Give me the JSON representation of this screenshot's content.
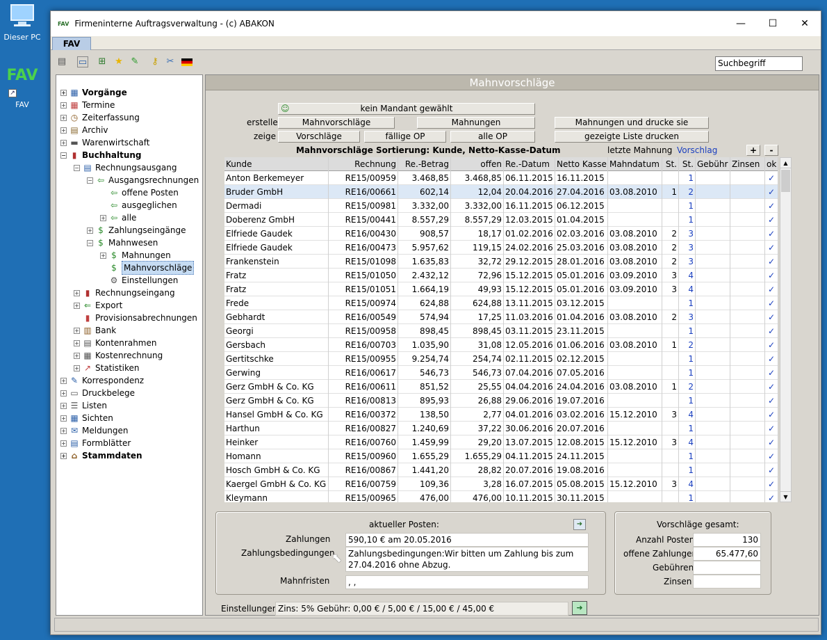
{
  "desktop": {
    "pc_label": "Dieser PC",
    "fav_big": "FAV",
    "fav_label": "FAV"
  },
  "window": {
    "title": "Firmeninterne Auftragsverwaltung - (c) ABAKON",
    "app_icon": "FAV",
    "minimize": "—",
    "maximize": "☐",
    "close": "✕"
  },
  "tab": {
    "label": "FAV"
  },
  "search": {
    "placeholder": "Suchbegriff"
  },
  "tree": [
    {
      "label": "Vorgänge",
      "bold": true,
      "level": 0,
      "exp": "+",
      "icon": "docs-icon"
    },
    {
      "label": "Termine",
      "level": 0,
      "exp": "+",
      "icon": "calendar-icon"
    },
    {
      "label": "Zeiterfassung",
      "level": 0,
      "exp": "+",
      "icon": "clock-icon"
    },
    {
      "label": "Archiv",
      "level": 0,
      "exp": "+",
      "icon": "archive-icon"
    },
    {
      "label": "Warenwirtschaft",
      "level": 0,
      "exp": "+",
      "icon": "truck-icon"
    },
    {
      "label": "Buchhaltung",
      "bold": true,
      "level": 0,
      "exp": "−",
      "icon": "chart-icon"
    },
    {
      "label": "Rechnungsausgang",
      "level": 1,
      "exp": "−",
      "icon": "invoice-out-icon"
    },
    {
      "label": "Ausgangsrechnungen",
      "level": 2,
      "exp": "−",
      "icon": "doc-arrow-icon"
    },
    {
      "label": "offene Posten",
      "level": 3,
      "exp": "",
      "icon": "doc-arrow-icon"
    },
    {
      "label": "ausgeglichen",
      "level": 3,
      "exp": "",
      "icon": "doc-arrow-icon"
    },
    {
      "label": "alle",
      "level": 3,
      "exp": "+",
      "icon": "doc-arrow-icon"
    },
    {
      "label": "Zahlungseingänge",
      "level": 2,
      "exp": "+",
      "icon": "payment-icon"
    },
    {
      "label": "Mahnwesen",
      "level": 2,
      "exp": "−",
      "icon": "dunning-icon"
    },
    {
      "label": "Mahnungen",
      "level": 3,
      "exp": "+",
      "icon": "dunning-icon"
    },
    {
      "label": "Mahnvorschläge",
      "level": 3,
      "exp": "",
      "icon": "dunning-icon",
      "selected": true
    },
    {
      "label": "Einstellungen",
      "level": 3,
      "exp": "",
      "icon": "gear-icon"
    },
    {
      "label": "Rechnungseingang",
      "level": 1,
      "exp": "+",
      "icon": "chart-icon"
    },
    {
      "label": "Export",
      "level": 1,
      "exp": "+",
      "icon": "export-icon"
    },
    {
      "label": "Provisionsabrechnungen",
      "level": 1,
      "exp": "",
      "icon": "commission-icon"
    },
    {
      "label": "Bank",
      "level": 1,
      "exp": "+",
      "icon": "bank-icon"
    },
    {
      "label": "Kontenrahmen",
      "level": 1,
      "exp": "+",
      "icon": "ledger-icon"
    },
    {
      "label": "Kostenrechnung",
      "level": 1,
      "exp": "+",
      "icon": "calculator-icon"
    },
    {
      "label": "Statistiken",
      "level": 1,
      "exp": "+",
      "icon": "stats-icon"
    },
    {
      "label": "Korrespondenz",
      "level": 0,
      "exp": "+",
      "icon": "letter-icon"
    },
    {
      "label": "Druckbelege",
      "level": 0,
      "exp": "+",
      "icon": "printer-icon"
    },
    {
      "label": "Listen",
      "level": 0,
      "exp": "+",
      "icon": "list-icon"
    },
    {
      "label": "Sichten",
      "level": 0,
      "exp": "+",
      "icon": "grid-icon"
    },
    {
      "label": "Meldungen",
      "level": 0,
      "exp": "+",
      "icon": "mail-icon"
    },
    {
      "label": "Formblätter",
      "level": 0,
      "exp": "+",
      "icon": "form-icon"
    },
    {
      "label": "Stammdaten",
      "bold": true,
      "level": 0,
      "exp": "+",
      "icon": "house-icon"
    }
  ],
  "main": {
    "title": "Mahnvorschläge",
    "mandant_button": "kein Mandant gewählt",
    "erstelle_label": "erstelle",
    "zeige_label": "zeige",
    "buttons": {
      "mahnvorschlaege": "Mahnvorschläge",
      "mahnungen": "Mahnungen",
      "mahnungen_drucken": "Mahnungen und drucke sie",
      "vorschlaege": "Vorschläge",
      "faellige_op": "fällige OP",
      "alle_op": "alle OP",
      "liste_drucken": "gezeigte Liste drucken",
      "plus": "+",
      "minus": "-"
    },
    "sort_label": "Mahnvorschläge Sortierung: Kunde, Netto-Kasse-Datum",
    "letzte_mahnung_label": "letzte Mahnung",
    "vorschlag_link": "Vorschlag",
    "columns": [
      "Kunde",
      "Rechnung",
      "Re.-Betrag",
      "offen",
      "Re.-Datum",
      "Netto Kasse",
      "Mahndatum",
      "St.",
      "St.",
      "Gebühr",
      "Zinsen",
      "ok"
    ],
    "rows": [
      [
        "Anton Berkemeyer",
        "RE15/00959",
        "3.468,85",
        "3.468,85",
        "06.11.2015",
        "16.11.2015",
        "",
        "",
        "1",
        "",
        "",
        "✓"
      ],
      [
        "Bruder GmbH",
        "RE16/00661",
        "602,14",
        "12,04",
        "20.04.2016",
        "27.04.2016",
        "03.08.2010",
        "1",
        "2",
        "",
        "",
        "✓"
      ],
      [
        "Dermadi",
        "RE15/00981",
        "3.332,00",
        "3.332,00",
        "16.11.2015",
        "06.12.2015",
        "",
        "",
        "1",
        "",
        "",
        "✓"
      ],
      [
        "Doberenz GmbH",
        "RE15/00441",
        "8.557,29",
        "8.557,29",
        "12.03.2015",
        "01.04.2015",
        "",
        "",
        "1",
        "",
        "",
        "✓"
      ],
      [
        "Elfriede Gaudek",
        "RE16/00430",
        "908,57",
        "18,17",
        "01.02.2016",
        "02.03.2016",
        "03.08.2010",
        "2",
        "3",
        "",
        "",
        "✓"
      ],
      [
        "Elfriede Gaudek",
        "RE16/00473",
        "5.957,62",
        "119,15",
        "24.02.2016",
        "25.03.2016",
        "03.08.2010",
        "2",
        "3",
        "",
        "",
        "✓"
      ],
      [
        "Frankenstein",
        "RE15/01098",
        "1.635,83",
        "32,72",
        "29.12.2015",
        "28.01.2016",
        "03.08.2010",
        "2",
        "3",
        "",
        "",
        "✓"
      ],
      [
        "Fratz",
        "RE15/01050",
        "2.432,12",
        "72,96",
        "15.12.2015",
        "05.01.2016",
        "03.09.2010",
        "3",
        "4",
        "",
        "",
        "✓"
      ],
      [
        "Fratz",
        "RE15/01051",
        "1.664,19",
        "49,93",
        "15.12.2015",
        "05.01.2016",
        "03.09.2010",
        "3",
        "4",
        "",
        "",
        "✓"
      ],
      [
        "Frede",
        "RE15/00974",
        "624,88",
        "624,88",
        "13.11.2015",
        "03.12.2015",
        "",
        "",
        "1",
        "",
        "",
        "✓"
      ],
      [
        "Gebhardt",
        "RE16/00549",
        "574,94",
        "17,25",
        "11.03.2016",
        "01.04.2016",
        "03.08.2010",
        "2",
        "3",
        "",
        "",
        "✓"
      ],
      [
        "Georgi",
        "RE15/00958",
        "898,45",
        "898,45",
        "03.11.2015",
        "23.11.2015",
        "",
        "",
        "1",
        "",
        "",
        "✓"
      ],
      [
        "Gersbach",
        "RE16/00703",
        "1.035,90",
        "31,08",
        "12.05.2016",
        "01.06.2016",
        "03.08.2010",
        "1",
        "2",
        "",
        "",
        "✓"
      ],
      [
        "Gertitschke",
        "RE15/00955",
        "9.254,74",
        "254,74",
        "02.11.2015",
        "02.12.2015",
        "",
        "",
        "1",
        "",
        "",
        "✓"
      ],
      [
        "Gerwing",
        "RE16/00617",
        "546,73",
        "546,73",
        "07.04.2016",
        "07.05.2016",
        "",
        "",
        "1",
        "",
        "",
        "✓"
      ],
      [
        "Gerz GmbH & Co. KG",
        "RE16/00611",
        "851,52",
        "25,55",
        "04.04.2016",
        "24.04.2016",
        "03.08.2010",
        "1",
        "2",
        "",
        "",
        "✓"
      ],
      [
        "Gerz GmbH & Co. KG",
        "RE16/00813",
        "895,93",
        "26,88",
        "29.06.2016",
        "19.07.2016",
        "",
        "",
        "1",
        "",
        "",
        "✓"
      ],
      [
        "Hansel GmbH & Co. KG",
        "RE16/00372",
        "138,50",
        "2,77",
        "04.01.2016",
        "03.02.2016",
        "15.12.2010",
        "3",
        "4",
        "",
        "",
        "✓"
      ],
      [
        "Harthun",
        "RE16/00827",
        "1.240,69",
        "37,22",
        "30.06.2016",
        "20.07.2016",
        "",
        "",
        "1",
        "",
        "",
        "✓"
      ],
      [
        "Heinker",
        "RE16/00760",
        "1.459,99",
        "29,20",
        "13.07.2015",
        "12.08.2015",
        "15.12.2010",
        "3",
        "4",
        "",
        "",
        "✓"
      ],
      [
        "Homann",
        "RE15/00960",
        "1.655,29",
        "1.655,29",
        "04.11.2015",
        "24.11.2015",
        "",
        "",
        "1",
        "",
        "",
        "✓"
      ],
      [
        "Hosch GmbH & Co. KG",
        "RE16/00867",
        "1.441,20",
        "28,82",
        "20.07.2016",
        "19.08.2016",
        "",
        "",
        "1",
        "",
        "",
        "✓"
      ],
      [
        "Kaergel GmbH & Co. KG",
        "RE16/00759",
        "109,36",
        "3,28",
        "16.07.2015",
        "05.08.2015",
        "15.12.2010",
        "3",
        "4",
        "",
        "",
        "✓"
      ],
      [
        "Kleymann",
        "RE15/00965",
        "476,00",
        "476,00",
        "10.11.2015",
        "30.11.2015",
        "",
        "",
        "1",
        "",
        "",
        "✓"
      ]
    ],
    "detail": {
      "title": "aktueller Posten:",
      "zahlungen_label": "Zahlungen",
      "zahlungen_value": "590,10 € am 20.05.2016",
      "bedingungen_label": "Zahlungsbedingungen",
      "bedingungen_value": "Zahlungsbedingungen:Wir bitten um Zahlung bis zum 27.04.2016 ohne Abzug.",
      "mahnfristen_label": "Mahnfristen",
      "mahnfristen_value": ", ,"
    },
    "summary": {
      "title": "Vorschläge gesamt:",
      "anzahl_label": "Anzahl Posten",
      "anzahl_value": "130",
      "offene_label": "offene Zahlungen",
      "offene_value": "65.477,60",
      "gebuehren_label": "Gebühren",
      "gebuehren_value": "",
      "zinsen_label": "Zinsen",
      "zinsen_value": ""
    },
    "einstellungen": {
      "label": "Einstellungen",
      "value": "Zins: 5% Gebühr: 0,00 € / 5,00 € / 15,00 € / 45,00 €"
    }
  },
  "colors": {
    "accent": "#1a3fbf",
    "selection": "#dce8f6",
    "header_bar": "#bcb8ad"
  }
}
